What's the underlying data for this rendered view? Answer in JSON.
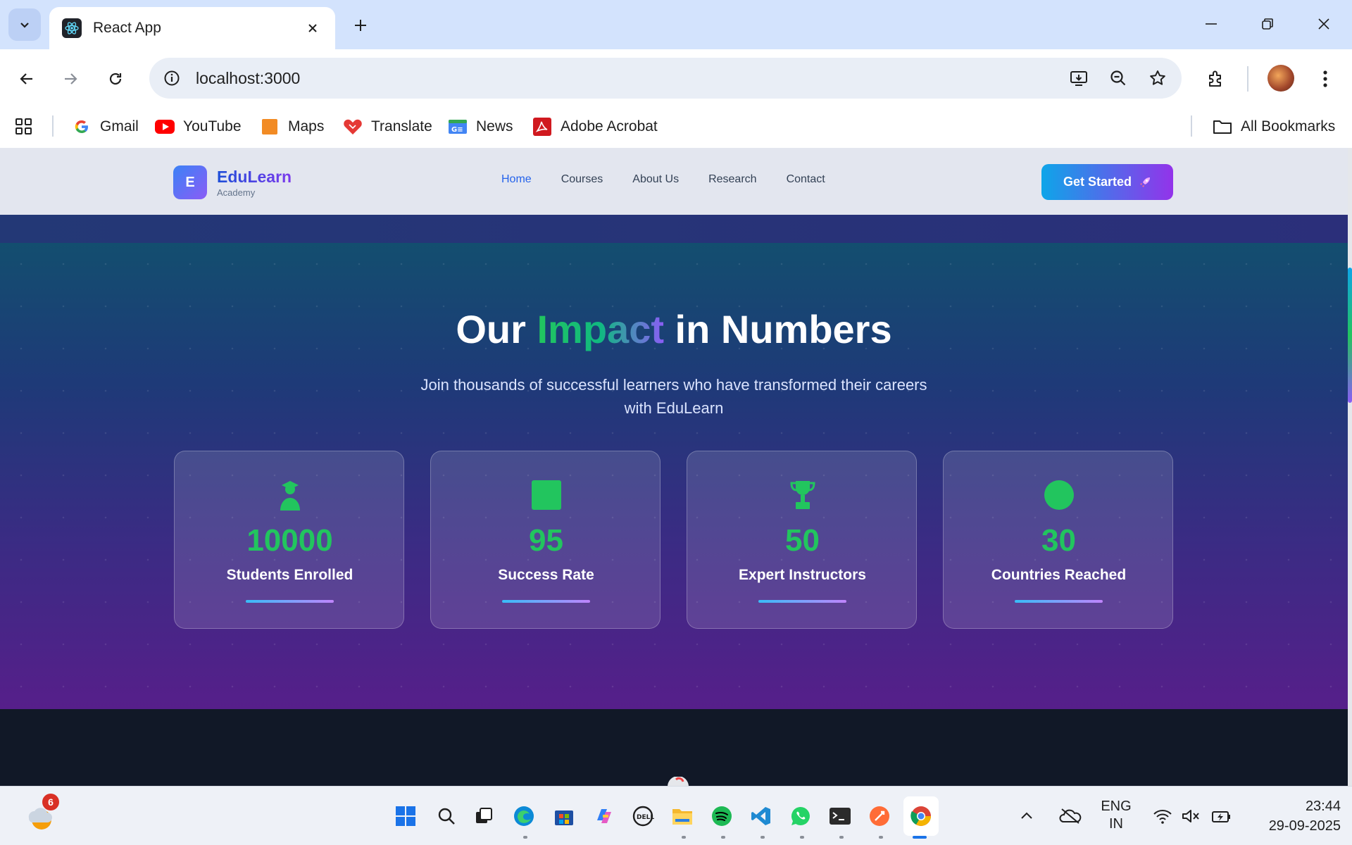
{
  "browser": {
    "tab_title": "React App",
    "url": "localhost:3000",
    "bookmarks": [
      {
        "label": "Gmail",
        "icon": "gmail-icon"
      },
      {
        "label": "YouTube",
        "icon": "youtube-icon"
      },
      {
        "label": "Maps",
        "icon": "maps-icon"
      },
      {
        "label": "Translate",
        "icon": "translate-icon"
      },
      {
        "label": "News",
        "icon": "news-icon"
      },
      {
        "label": "Adobe Acrobat",
        "icon": "adobe-acrobat-icon"
      }
    ],
    "all_bookmarks_label": "All Bookmarks"
  },
  "site": {
    "brand": {
      "logo_letter": "E",
      "name": "EduLearn",
      "tagline": "Academy"
    },
    "nav": [
      {
        "label": "Home",
        "active": true
      },
      {
        "label": "Courses",
        "active": false
      },
      {
        "label": "About Us",
        "active": false
      },
      {
        "label": "Research",
        "active": false
      },
      {
        "label": "Contact",
        "active": false
      }
    ],
    "cta_label": "Get Started",
    "colors": {
      "accent": "#2563eb",
      "stat_value": "#22c55e",
      "cta_start": "#0ea5e9",
      "cta_end": "#9333ea"
    }
  },
  "impact": {
    "title_before": "Our ",
    "title_accent": "Impact",
    "title_after": " in Numbers",
    "subtitle": "Join thousands of successful learners who have transformed their careers with EduLearn",
    "stats": [
      {
        "value": "10000",
        "label": "Students Enrolled",
        "icon": "graduate-icon"
      },
      {
        "value": "95",
        "label": "Success Rate",
        "icon": "square-icon"
      },
      {
        "value": "50",
        "label": "Expert Instructors",
        "icon": "trophy-icon"
      },
      {
        "value": "30",
        "label": "Countries Reached",
        "icon": "globe-dot-icon"
      }
    ]
  },
  "taskbar": {
    "weather_badge": "6",
    "language_line1": "ENG",
    "language_line2": "IN",
    "time": "23:44",
    "date": "29-09-2025"
  }
}
